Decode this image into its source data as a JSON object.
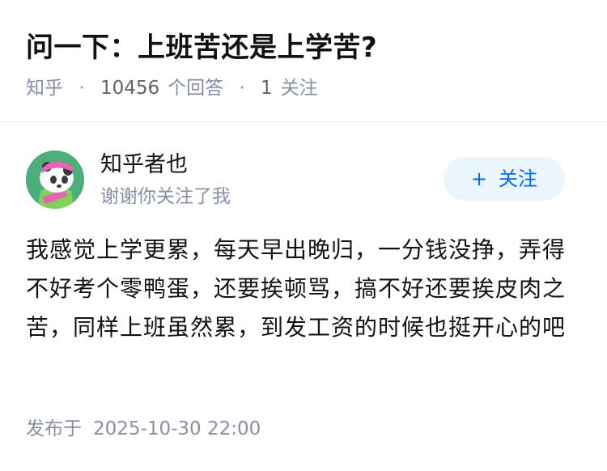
{
  "question": {
    "title": "问一下：上班苦还是上学苦?",
    "source": "知乎",
    "answer_count": "10456",
    "answer_unit": "个回答",
    "follow_count": "1",
    "follow_unit": "关注",
    "separator": "·"
  },
  "answer": {
    "author": {
      "name": "知乎者也",
      "bio": "谢谢你关注了我",
      "avatar_icon": "panda-mascot-avatar"
    },
    "follow_button": {
      "plus": "+",
      "label": "关注"
    },
    "content": "我感觉上学更累，每天早出晚归，一分钱没挣，弄得不好考个零鸭蛋，还要挨顿骂，搞不好还要挨皮肉之苦，同样上班虽然累，到发工资的时候也挺开心的吧",
    "publish_label": "发布于",
    "publish_date": "2025-10-30 22:00"
  },
  "colors": {
    "title": "#121212",
    "meta": "#8590a6",
    "accent": "#0066ff",
    "follow_bg": "#ebf5fd",
    "avatar_bg": "#4cae7a"
  }
}
